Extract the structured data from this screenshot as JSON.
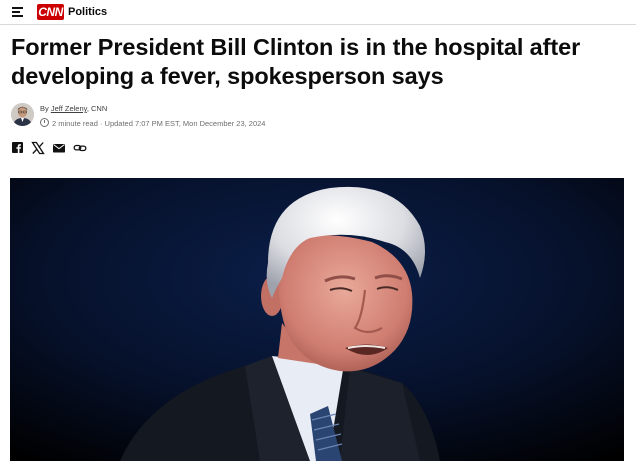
{
  "header": {
    "brand": "CNN",
    "section": "Politics"
  },
  "article": {
    "headline": "Former President Bill Clinton is in the hospital after developing a fever, spokesperson says",
    "byline_prefix": "By ",
    "author": "Jeff Zeleny",
    "outlet": ", CNN",
    "read_time": "2 minute read",
    "separator": " · ",
    "updated": "Updated 7:07 PM EST, Mon December 23, 2024"
  },
  "share": {
    "icons": [
      "facebook-icon",
      "x-icon",
      "email-icon",
      "copy-link-icon"
    ]
  },
  "colors": {
    "brand_red": "#cc0000",
    "text": "#0c0c0c",
    "meta_gray": "#6e6e6e"
  }
}
